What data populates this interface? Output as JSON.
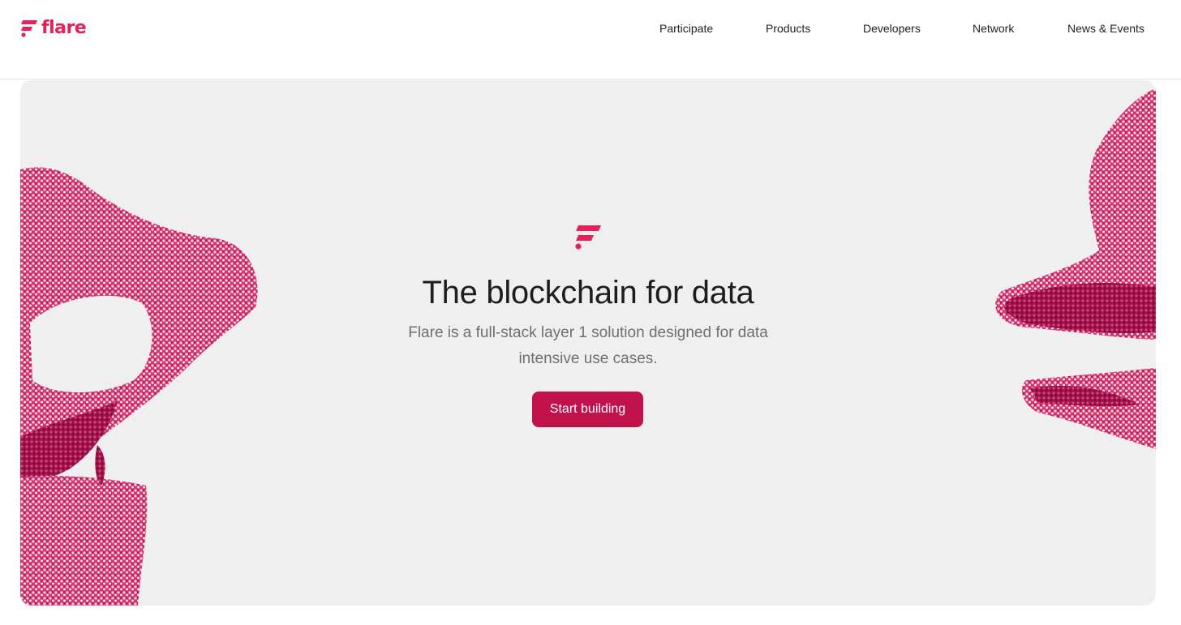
{
  "brand": {
    "name": "flare",
    "logo_icon": "flare-logo-icon",
    "accent_color": "#e62058",
    "button_color": "#c2124c"
  },
  "nav": {
    "items": [
      {
        "label": "Participate"
      },
      {
        "label": "Products"
      },
      {
        "label": "Developers"
      },
      {
        "label": "Network"
      },
      {
        "label": "News & Events"
      }
    ]
  },
  "hero": {
    "title": "The blockchain for data",
    "subtitle": "Flare is a full-stack layer 1 solution designed for data intensive use cases.",
    "cta_label": "Start building",
    "background_color": "#f0eff0"
  }
}
